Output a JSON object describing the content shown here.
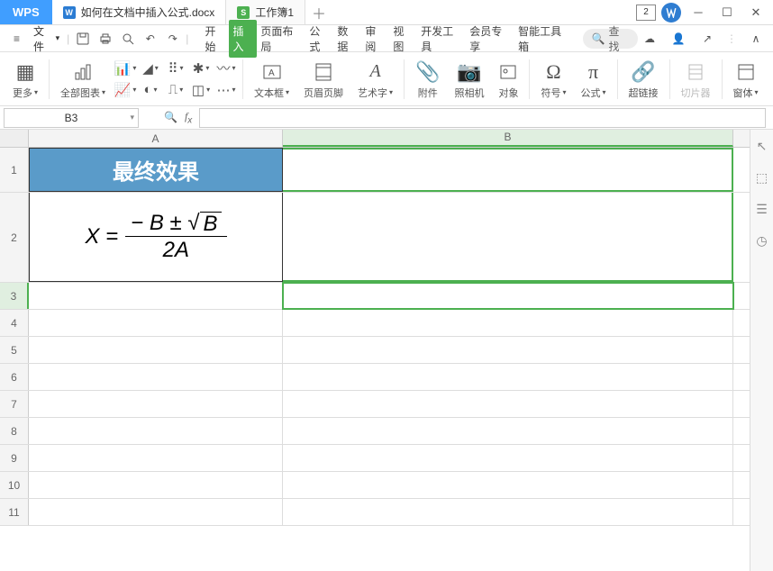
{
  "app": {
    "brand": "WPS"
  },
  "tabs": [
    {
      "label": "如何在文档中插入公式.docx",
      "icon": "W",
      "color": "#2b7cd3"
    },
    {
      "label": "工作簿1",
      "icon": "S",
      "color": "#4cb050"
    }
  ],
  "title_right": {
    "num": "2"
  },
  "file_menu": {
    "label": "文件"
  },
  "menu_tabs": [
    "开始",
    "插入",
    "页面布局",
    "公式",
    "数据",
    "审阅",
    "视图",
    "开发工具",
    "会员专享",
    "智能工具箱"
  ],
  "menu_active_index": 1,
  "search": {
    "placeholder": "查找"
  },
  "ribbon": {
    "more": "更多",
    "all_charts": "全部图表",
    "textbox": "文本框",
    "hf": "页眉页脚",
    "wordart": "艺术字",
    "attach": "附件",
    "camera": "照相机",
    "object": "对象",
    "symbol": "符号",
    "equation": "公式",
    "hyperlink": "超链接",
    "slicer": "切片器",
    "window": "窗体"
  },
  "namebox": {
    "ref": "B3"
  },
  "columns": [
    "A",
    "B"
  ],
  "rows": [
    "1",
    "2",
    "3",
    "4",
    "5",
    "6",
    "7",
    "8",
    "9",
    "10",
    "11"
  ],
  "cells": {
    "A1": "最终效果",
    "A2": {
      "lhs": "X =",
      "num_pre": "− B ±",
      "rad_body": "B",
      "den": "2A"
    }
  }
}
